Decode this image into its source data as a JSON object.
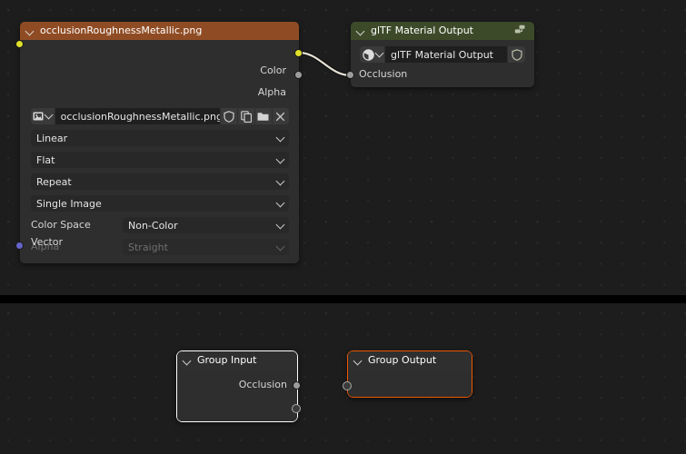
{
  "editor": {
    "background_color": "#1d1d1d",
    "grid_dot_color": "#2b2b2b",
    "divider_color": "#000000"
  },
  "nodes": {
    "image_texture": {
      "title": "occlusionRoughnessMetallic.png",
      "header_color": "#8f4c24",
      "body_color": "#2e2e2e",
      "outputs": [
        {
          "name": "Color",
          "label": "Color",
          "color": "#e0e02a"
        },
        {
          "name": "Alpha",
          "label": "Alpha",
          "color": "#9d9d9d"
        }
      ],
      "inputs": [
        {
          "name": "Vector",
          "label": "Vector",
          "color": "#6363c8"
        }
      ],
      "datablock": {
        "icon": "image-icon",
        "value": "occlusionRoughnessMetallic.png",
        "buttons": [
          {
            "icon": "shield-icon",
            "name": "fake-user-button"
          },
          {
            "icon": "copy-icon",
            "name": "new-image-button"
          },
          {
            "icon": "folder-icon",
            "name": "open-image-button"
          },
          {
            "icon": "x-icon",
            "name": "unlink-image-button"
          }
        ]
      },
      "dropdowns": [
        {
          "name": "interpolation",
          "value": "Linear"
        },
        {
          "name": "projection",
          "value": "Flat"
        },
        {
          "name": "extension",
          "value": "Repeat"
        },
        {
          "name": "source",
          "value": "Single Image"
        }
      ],
      "properties": [
        {
          "name": "color-space",
          "label": "Color Space",
          "value": "Non-Color",
          "disabled": false
        },
        {
          "name": "alpha-mode",
          "label": "Alpha",
          "value": "Straight",
          "disabled": true
        }
      ]
    },
    "gltf_material_output": {
      "title": "glTF Material Output",
      "header_color": "#3c4a29",
      "body_color": "#2e2e2e",
      "header_icon": "nodetree-icon",
      "datablock": {
        "icon": "nodetree-sphere-icon",
        "value": "glTF Material Output",
        "buttons": [
          {
            "icon": "shield-icon",
            "name": "fake-user-button"
          }
        ]
      },
      "inputs": [
        {
          "name": "Occlusion",
          "label": "Occlusion",
          "color": "#9d9d9d"
        }
      ]
    },
    "group_input": {
      "title": "Group Input",
      "header_color": "#2f2f2f",
      "border_color": "#ffffff",
      "outputs": [
        {
          "name": "Occlusion",
          "label": "Occlusion",
          "color": "#9d9d9d",
          "hollow": false
        },
        {
          "name": "virtual",
          "label": "",
          "color": "#3b3b3b",
          "hollow": true
        }
      ]
    },
    "group_output": {
      "title": "Group Output",
      "header_color": "#2f2f2f",
      "border_color": "#ed5700",
      "inputs": [
        {
          "name": "virtual",
          "label": "",
          "color": "#3b3b3b",
          "hollow": true
        }
      ]
    }
  },
  "links": [
    {
      "name": "color-to-occlusion",
      "from": "image_texture.Color",
      "to": "gltf_material_output.Occlusion",
      "color": "#e8e4d6"
    }
  ]
}
